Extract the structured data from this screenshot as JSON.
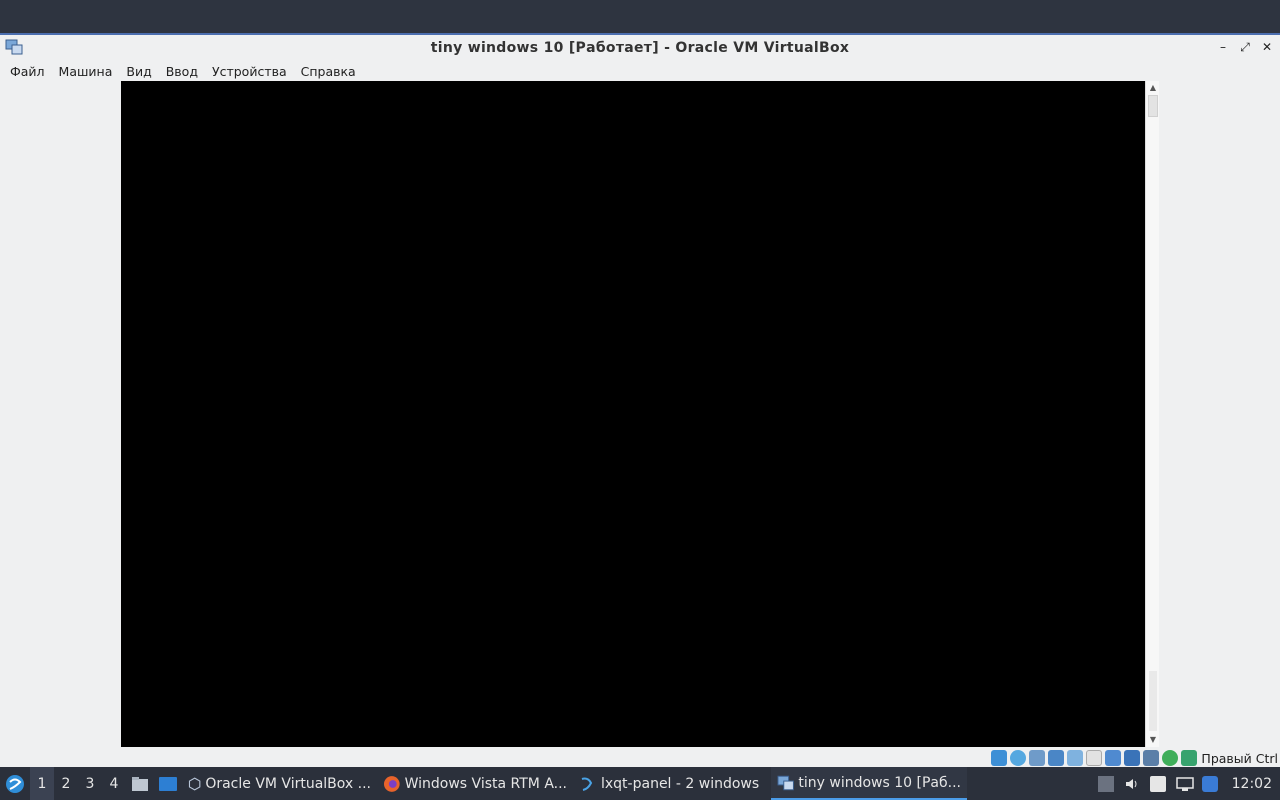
{
  "window": {
    "title": "tiny windows 10 [Работает] - Oracle VM VirtualBox",
    "controls": {
      "minimize": "–",
      "maximize": "⤢",
      "close": "✕"
    }
  },
  "menubar": {
    "items": [
      "Файл",
      "Машина",
      "Вид",
      "Ввод",
      "Устройства",
      "Справка"
    ]
  },
  "statusbar": {
    "host_key": "Правый Ctrl",
    "icons": [
      "hard-disk-icon",
      "optical-drive-icon",
      "audio-icon",
      "network-icon",
      "usb-icon",
      "shared-folders-icon",
      "display-icon",
      "video-capture-icon",
      "virtualization-icon",
      "mouse-integration-icon",
      "keyboard-icon"
    ]
  },
  "taskbar": {
    "desktops": [
      "1",
      "2",
      "3",
      "4"
    ],
    "tasks": [
      {
        "label": "Oracle VM VirtualBox ...",
        "icon": "virtualbox-icon"
      },
      {
        "label": "Windows Vista RTM A...",
        "icon": "firefox-icon"
      },
      {
        "label": "lxqt-panel - 2 windows",
        "icon": "lxqt-panel-icon"
      },
      {
        "label": "tiny windows 10 [Раб...",
        "icon": "virtualbox-vm-icon"
      }
    ],
    "clock": "12:02"
  },
  "colors": {
    "taskbar_bg": "#2b303b",
    "window_bg": "#eff0f1",
    "vm_screen": "#000000",
    "accent": "#4b9ce8"
  }
}
